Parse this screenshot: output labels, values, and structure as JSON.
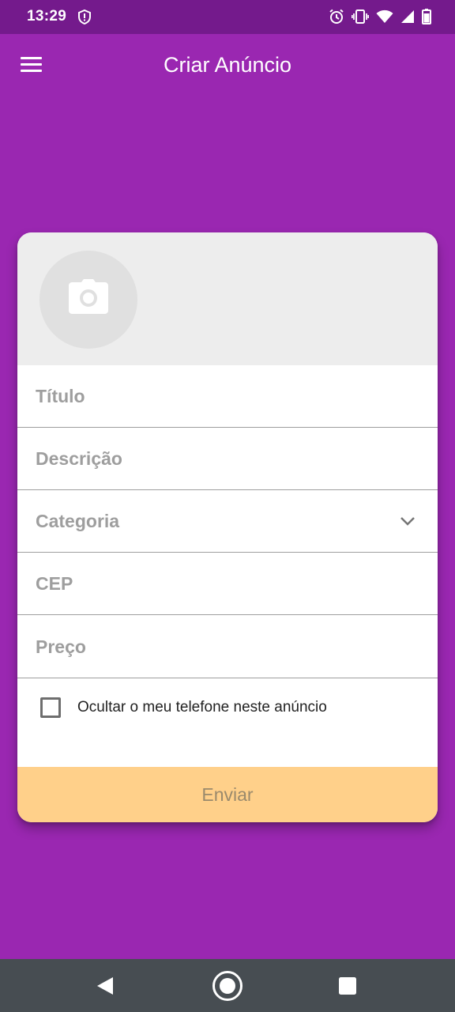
{
  "status_bar": {
    "time": "13:29",
    "icons": [
      "shield-icon",
      "alarm-icon",
      "vibrate-icon",
      "wifi-icon",
      "signal-icon",
      "battery-icon"
    ]
  },
  "app_bar": {
    "title": "Criar Anúncio",
    "menu_icon": "menu-icon"
  },
  "form": {
    "photo_icon": "camera-icon",
    "fields": [
      {
        "label": "Título"
      },
      {
        "label": "Descrição"
      },
      {
        "label": "Categoria",
        "type": "dropdown"
      },
      {
        "label": "CEP"
      },
      {
        "label": "Preço"
      }
    ],
    "checkbox": {
      "label": "Ocultar o meu telefone neste anúncio",
      "checked": false
    },
    "submit_label": "Enviar"
  },
  "colors": {
    "background": "#9a27b1",
    "status_bar": "#741a8c",
    "button": "#ffd08a",
    "nav_bar": "#474d52"
  },
  "nav_bar": {
    "icons": [
      "back-icon",
      "home-icon",
      "recents-icon"
    ]
  }
}
